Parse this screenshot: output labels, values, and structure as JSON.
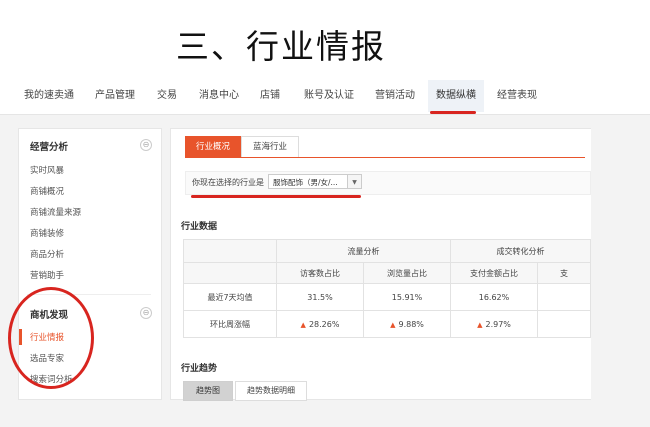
{
  "slide_title": "三、行业情报",
  "topnav": {
    "items": [
      "我的速卖通",
      "产品管理",
      "交易",
      "消息中心",
      "店铺",
      "账号及认证",
      "营销活动",
      "数据纵横",
      "经营表现"
    ],
    "active_index": 7
  },
  "sidebar": {
    "section1": {
      "title": "经营分析",
      "toggle": "⊖",
      "items": [
        "实时风暴",
        "商铺概况",
        "商铺流量来源",
        "商铺装修",
        "商品分析",
        "营销助手"
      ]
    },
    "section2": {
      "title": "商机发现",
      "toggle": "⊖",
      "items": [
        "行业情报",
        "选品专家",
        "搜索词分析"
      ],
      "active_index": 0
    }
  },
  "main": {
    "tabs": [
      "行业概况",
      "蓝海行业"
    ],
    "active_tab": 0,
    "filter": {
      "label": "你现在选择的行业是",
      "selected": "服饰配饰（男/女/...",
      "arrow": "▼"
    },
    "section_data_title": "行业数据",
    "table": {
      "group_headers": [
        "流量分析",
        "成交转化分析"
      ],
      "sub_headers": [
        "访客数占比",
        "浏览量占比",
        "支付金额占比",
        "支"
      ],
      "rows": [
        {
          "label": "最近7天均值",
          "values": [
            "31.5%",
            "15.91%",
            "16.62%",
            ""
          ],
          "arrows": [
            false,
            false,
            false,
            false
          ]
        },
        {
          "label": "环比周涨幅",
          "values": [
            "28.26%",
            "9.88%",
            "2.97%",
            ""
          ],
          "arrows": [
            true,
            true,
            true,
            false
          ]
        }
      ]
    },
    "section_trend_title": "行业趋势",
    "trend_tabs": [
      "趋势图",
      "趋势数据明细"
    ],
    "active_trend_tab": 0
  },
  "colors": {
    "accent": "#e8542b",
    "annotation_red": "#d8251f"
  }
}
